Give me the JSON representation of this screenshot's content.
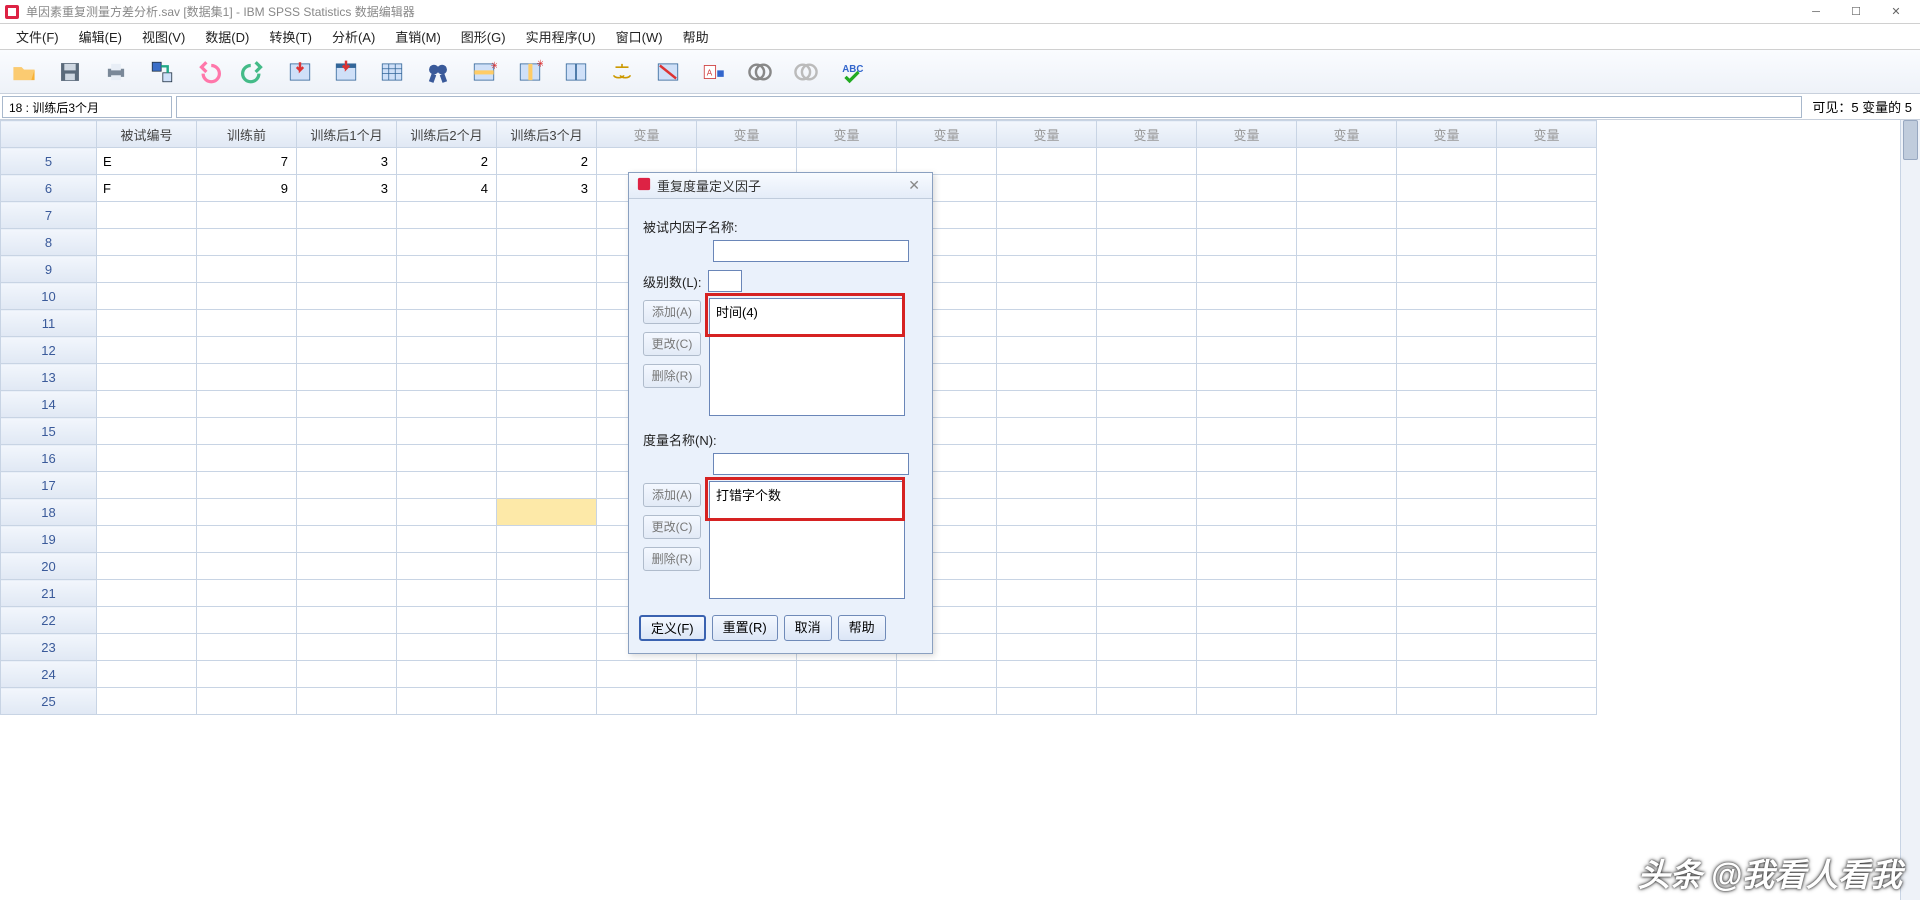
{
  "title": "单因素重复测量方差分析.sav [数据集1] - IBM SPSS Statistics 数据编辑器",
  "menu": [
    "文件(F)",
    "编辑(E)",
    "视图(V)",
    "数据(D)",
    "转换(T)",
    "分析(A)",
    "直销(M)",
    "图形(G)",
    "实用程序(U)",
    "窗口(W)",
    "帮助"
  ],
  "refcell": "18 : 训练后3个月",
  "visible_label": "可见：5 变量的 5",
  "columns": [
    "被试编号",
    "训练前",
    "训练后1个月",
    "训练后2个月",
    "训练后3个月"
  ],
  "var_label": "变量",
  "rows_start": 5,
  "rows_end": 25,
  "data_rows": [
    {
      "n": 5,
      "cells": [
        "E",
        "7",
        "3",
        "2",
        "2"
      ]
    },
    {
      "n": 6,
      "cells": [
        "F",
        "9",
        "3",
        "4",
        "3"
      ]
    }
  ],
  "selected_row": 18,
  "selected_col": 4,
  "dialog": {
    "title": "重复度量定义因子",
    "factor_name_label": "被试内因子名称:",
    "levels_label": "级别数(L):",
    "factor_list_item": "时间(4)",
    "measure_label": "度量名称(N):",
    "measure_list_item": "打错字个数",
    "btn_add": "添加(A)",
    "btn_change": "更改(C)",
    "btn_remove": "删除(R)",
    "btn_define": "定义(F)",
    "btn_reset": "重置(R)",
    "btn_cancel": "取消",
    "btn_help": "帮助"
  },
  "watermark": "头条 @我看人看我"
}
